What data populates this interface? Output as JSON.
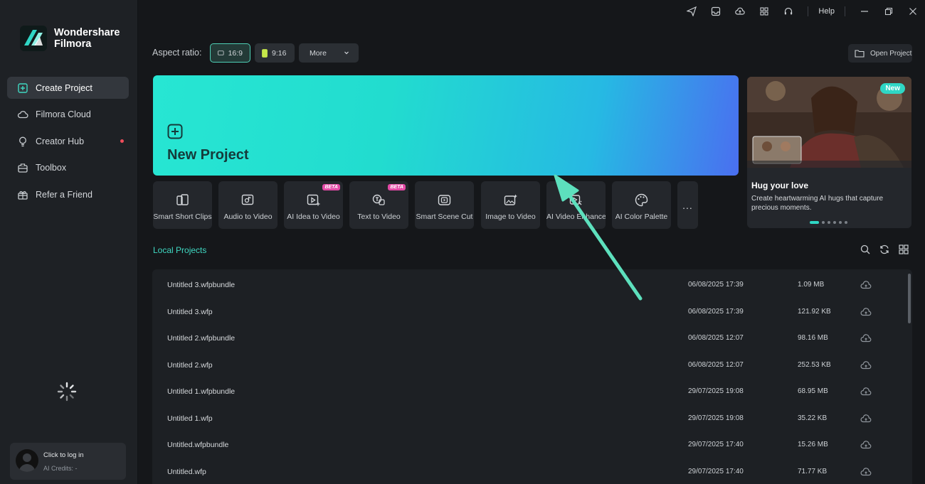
{
  "app": {
    "brand_line1": "Wondershare",
    "brand_line2": "Filmora"
  },
  "titlebar": {
    "help": "Help"
  },
  "sidebar": {
    "items": [
      {
        "label": "Create Project"
      },
      {
        "label": "Filmora Cloud"
      },
      {
        "label": "Creator Hub"
      },
      {
        "label": "Toolbox"
      },
      {
        "label": "Refer a Friend"
      }
    ],
    "login_title": "Click to log in",
    "login_credits": "AI Credits: -"
  },
  "aspect": {
    "label": "Aspect ratio:",
    "ratio1": "16:9",
    "ratio2": "9:16",
    "more": "More"
  },
  "open_project": "Open Project",
  "new_project": {
    "label": "New Project"
  },
  "tools": [
    {
      "label": "Smart Short Clips",
      "beta": ""
    },
    {
      "label": "Audio to Video",
      "beta": ""
    },
    {
      "label": "AI Idea to Video",
      "beta": "BETA"
    },
    {
      "label": "Text to Video",
      "beta": "BETA"
    },
    {
      "label": "Smart Scene Cut",
      "beta": ""
    },
    {
      "label": "Image to Video",
      "beta": ""
    },
    {
      "label": "AI Video Enhance",
      "beta": ""
    },
    {
      "label": "AI Color Palette",
      "beta": ""
    }
  ],
  "tools_more": "...",
  "banner": {
    "badge": "New",
    "title": "Hug your love",
    "desc": "Create heartwarming AI hugs that capture precious moments."
  },
  "local_projects": {
    "title": "Local Projects",
    "rows": [
      {
        "name": "Untitled 3.wfpbundle",
        "date": "06/08/2025 17:39",
        "size": "1.09 MB"
      },
      {
        "name": "Untitled 3.wfp",
        "date": "06/08/2025 17:39",
        "size": "121.92 KB"
      },
      {
        "name": "Untitled 2.wfpbundle",
        "date": "06/08/2025 12:07",
        "size": "98.16 MB"
      },
      {
        "name": "Untitled 2.wfp",
        "date": "06/08/2025 12:07",
        "size": "252.53 KB"
      },
      {
        "name": "Untitled 1.wfpbundle",
        "date": "29/07/2025 19:08",
        "size": "68.95 MB"
      },
      {
        "name": "Untitled 1.wfp",
        "date": "29/07/2025 19:08",
        "size": "35.22 KB"
      },
      {
        "name": "Untitled.wfpbundle",
        "date": "29/07/2025 17:40",
        "size": "15.26 MB"
      },
      {
        "name": "Untitled.wfp",
        "date": "29/07/2025 17:40",
        "size": "71.77 KB"
      }
    ]
  },
  "colors": {
    "accent": "#2fd7c5",
    "background": "#15171a",
    "sidebar": "#1e2125",
    "annotation_arrow": "#5de0bd"
  }
}
